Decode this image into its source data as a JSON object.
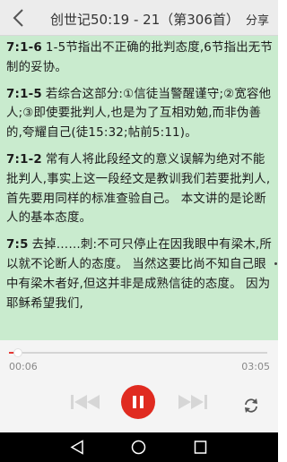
{
  "header": {
    "back_icon": "chevron-left-icon",
    "title": "创世记50:19 - 21（第306首）",
    "share_label": "分享"
  },
  "content": {
    "paragraphs": [
      {
        "ref": "7:1-6",
        "text": "1-5节指出不正确的批判态度,6节指出无节制的妥协。"
      },
      {
        "ref": "7:1-5",
        "text": "若综合这部分:①信徒当警醒谨守;②宽容他人;③即使要批判人,也是为了互相劝勉,而非伪善的,夸耀自己(徒15:32;帖前5:11)。"
      },
      {
        "ref": "7:1-2",
        "text": "常有人将此段经文的意义误解为绝对不能批判人,事实上这一段经文是教训我们若要批判人,首先要用同样的标准查验自己。 本文讲的是论断人的基本态度。"
      },
      {
        "ref": "7:5",
        "text": "去掉……刺:不可只停止在因我眼中有梁木,所以就不论断人的态度。 当然这要比尚不知自己眼中有梁木者好,但这并非是成熟信徒的态度。 因为耶稣希望我们,"
      }
    ]
  },
  "player": {
    "current_time": "00:06",
    "total_time": "03:05",
    "progress": 0.033,
    "accent_color": "#e02b20",
    "icons": {
      "prev": "skip-previous-icon",
      "play": "pause-icon",
      "next": "skip-next-icon",
      "mode": "repeat-icon"
    }
  },
  "navbar": {
    "icons": [
      "back-triangle-icon",
      "home-circle-icon",
      "recents-square-icon"
    ]
  }
}
